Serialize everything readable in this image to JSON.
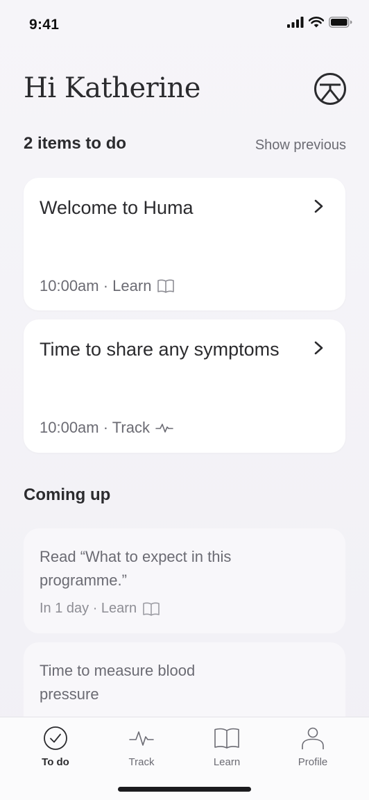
{
  "status": {
    "time": "9:41"
  },
  "header": {
    "greeting": "Hi Katherine"
  },
  "todo": {
    "heading": "2 items to do",
    "show_previous": "Show previous",
    "items": [
      {
        "title": "Welcome to Huma",
        "meta": "10:00am · Learn",
        "icon": "book-icon"
      },
      {
        "title": "Time to share any symptoms",
        "meta": "10:00am · Track",
        "icon": "pulse-icon"
      }
    ]
  },
  "coming_up": {
    "heading": "Coming up",
    "items": [
      {
        "title": "Read “What to expect in this programme.”",
        "meta": "In 1 day · Learn",
        "icon": "book-icon"
      },
      {
        "title": "Time to measure blood pressure"
      }
    ]
  },
  "tabs": [
    {
      "label": "To do",
      "icon": "check-circle-icon",
      "active": true
    },
    {
      "label": "Track",
      "icon": "pulse-icon"
    },
    {
      "label": "Learn",
      "icon": "book-icon"
    },
    {
      "label": "Profile",
      "icon": "person-icon"
    }
  ],
  "colors": {
    "text": "#2b2b2e",
    "muted": "#6b6b73",
    "background": "#f4f3f7",
    "card": "#ffffff"
  }
}
